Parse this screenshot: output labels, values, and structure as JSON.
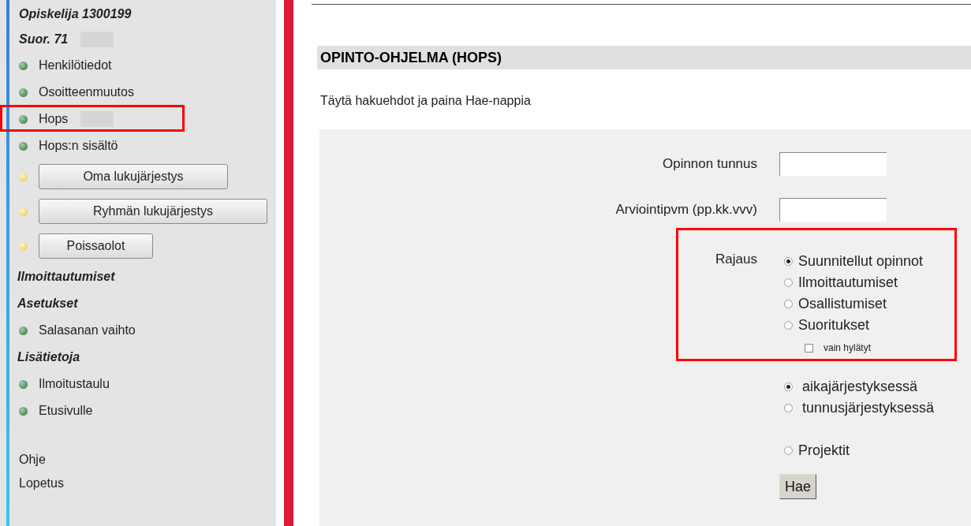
{
  "sidebar": {
    "header": [
      {
        "text": "Opiskelija 1300199"
      },
      {
        "text": "Suor. 71",
        "redacted": true
      }
    ],
    "items": [
      {
        "kind": "link",
        "label": "Henkilötiedot"
      },
      {
        "kind": "link",
        "label": "Osoitteenmuutos"
      },
      {
        "kind": "link",
        "label": "Hops",
        "annotated": true,
        "redacted": true
      },
      {
        "kind": "link",
        "label": "Hops:n sisältö"
      },
      {
        "kind": "button",
        "label": "Oma lukujärjestys"
      },
      {
        "kind": "button",
        "label": "Ryhmän lukujärjestys"
      },
      {
        "kind": "button",
        "label": "Poissaolot"
      },
      {
        "kind": "heading",
        "label": "Ilmoittautumiset"
      },
      {
        "kind": "heading",
        "label": "Asetukset"
      },
      {
        "kind": "link",
        "label": "Salasanan vaihto"
      },
      {
        "kind": "heading",
        "label": "Lisätietoja"
      },
      {
        "kind": "link",
        "label": "Ilmoitustaulu"
      },
      {
        "kind": "link",
        "label": "Etusivulle"
      },
      {
        "kind": "plain",
        "label": "Ohje"
      },
      {
        "kind": "plain",
        "label": "Lopetus"
      }
    ]
  },
  "page": {
    "title": "OPINTO-OHJELMA (HOPS)",
    "instruction": "Täytä hakuehdot ja paina Hae-nappia"
  },
  "form": {
    "fields": [
      {
        "label": "Opinnon tunnus"
      },
      {
        "label": "Arviointipvm (pp.kk.vvv)"
      }
    ],
    "scope": {
      "label": "Rajaus",
      "annotated": true,
      "options": [
        {
          "label": "Suunnitellut opinnot",
          "selected": true
        },
        {
          "label": "Ilmoittautumiset",
          "selected": false
        },
        {
          "label": "Osallistumiset",
          "selected": false
        },
        {
          "label": "Suoritukset",
          "selected": false
        }
      ],
      "checkbox": {
        "label": "vain hylätyt",
        "checked": false
      }
    },
    "order": [
      {
        "label": "aikajärjestyksessä",
        "selected": true
      },
      {
        "label": "tunnusjärjestyksessä",
        "selected": false
      }
    ],
    "projects": {
      "label": "Projektit",
      "selected": false
    },
    "submit": "Hae"
  }
}
